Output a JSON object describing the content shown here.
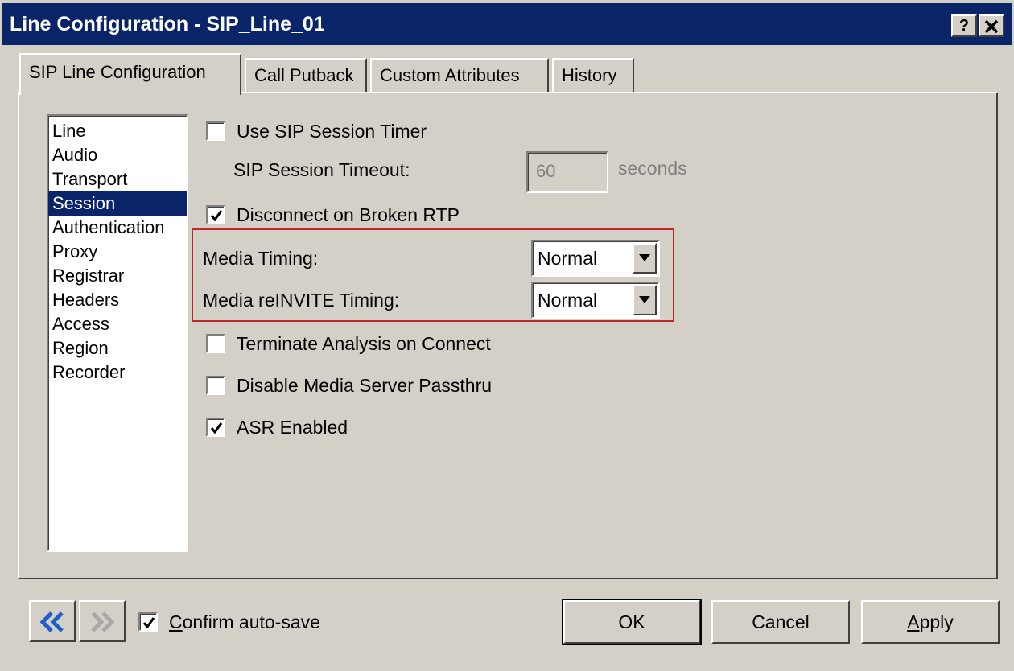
{
  "window": {
    "title": "Line Configuration - SIP_Line_01",
    "help_label": "?"
  },
  "tabs": [
    {
      "label": "SIP Line Configuration",
      "active": true
    },
    {
      "label": "Call Putback"
    },
    {
      "label": "Custom Attributes"
    },
    {
      "label": "History"
    }
  ],
  "sidebar": {
    "items": [
      "Line",
      "Audio",
      "Transport",
      "Session",
      "Authentication",
      "Proxy",
      "Registrar",
      "Headers",
      "Access",
      "Region",
      "Recorder"
    ],
    "selected": "Session"
  },
  "session": {
    "use_sip_session_timer": {
      "label": "Use SIP Session Timer",
      "checked": false
    },
    "sip_session_timeout": {
      "label": "SIP Session Timeout:",
      "value": "60",
      "suffix": "seconds"
    },
    "disconnect_on_broken_rtp": {
      "label": "Disconnect on Broken RTP",
      "checked": true
    },
    "media_timing": {
      "label": "Media Timing:",
      "value": "Normal"
    },
    "media_reinvite_timing": {
      "label": "Media reINVITE Timing:",
      "value": "Normal"
    },
    "terminate_analysis_on_connect": {
      "label": "Terminate Analysis on Connect",
      "checked": false
    },
    "disable_media_server_passthru": {
      "label": "Disable Media Server Passthru",
      "checked": false
    },
    "asr_enabled": {
      "label": "ASR Enabled",
      "checked": true
    }
  },
  "footer": {
    "confirm_autosave": {
      "label_accel": "C",
      "label_rest": "onfirm auto-save",
      "checked": true
    },
    "ok_label": "OK",
    "cancel_label": "Cancel",
    "apply_accel": "A",
    "apply_rest": "pply"
  },
  "colors": {
    "titlebar": "#0a246a",
    "selection": "#0a246a",
    "highlight_box": "#c0272d",
    "face": "#d4d0c8",
    "nav_arrow": "#1e5fc8"
  }
}
